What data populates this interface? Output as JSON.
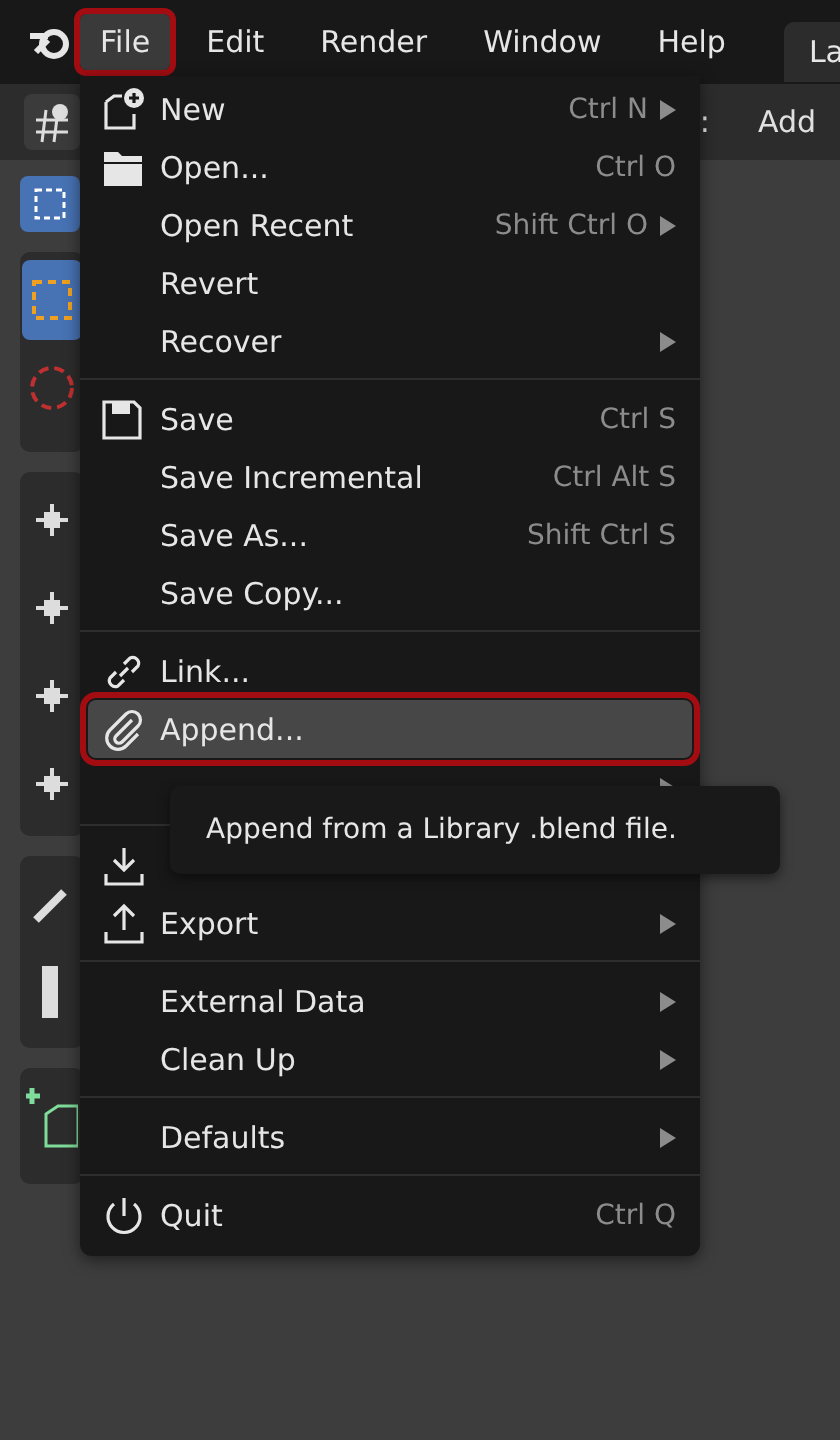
{
  "menubar": {
    "items": [
      {
        "label": "File",
        "selected": true,
        "annotated": true
      },
      {
        "label": "Edit",
        "selected": false,
        "annotated": false
      },
      {
        "label": "Render",
        "selected": false,
        "annotated": false
      },
      {
        "label": "Window",
        "selected": false,
        "annotated": false
      },
      {
        "label": "Help",
        "selected": false,
        "annotated": false
      }
    ],
    "workspace_tab": "La"
  },
  "header": {
    "separator_glyph": ":",
    "add_menu": "Add"
  },
  "file_menu": {
    "items": [
      {
        "kind": "item",
        "label": "New",
        "shortcut": "Ctrl N",
        "submenu": true,
        "selected": false,
        "annotated": false
      },
      {
        "kind": "item",
        "label": "Open...",
        "shortcut": "Ctrl O",
        "submenu": false,
        "selected": false,
        "annotated": false
      },
      {
        "kind": "item",
        "label": "Open Recent",
        "shortcut": "Shift Ctrl O",
        "submenu": true,
        "selected": false,
        "annotated": false
      },
      {
        "kind": "item",
        "label": "Revert",
        "submenu": false,
        "selected": false,
        "annotated": false
      },
      {
        "kind": "item",
        "label": "Recover",
        "submenu": true,
        "selected": false,
        "annotated": false
      },
      {
        "kind": "separator"
      },
      {
        "kind": "item",
        "label": "Save",
        "shortcut": "Ctrl S",
        "submenu": false,
        "selected": false,
        "annotated": false
      },
      {
        "kind": "item",
        "label": "Save Incremental",
        "shortcut": "Ctrl Alt S",
        "submenu": false,
        "selected": false,
        "annotated": false
      },
      {
        "kind": "item",
        "label": "Save As...",
        "shortcut": "Shift Ctrl S",
        "submenu": false,
        "selected": false,
        "annotated": false
      },
      {
        "kind": "item",
        "label": "Save Copy...",
        "submenu": false,
        "selected": false,
        "annotated": false
      },
      {
        "kind": "separator"
      },
      {
        "kind": "item",
        "label": "Link...",
        "submenu": false,
        "selected": false,
        "annotated": false
      },
      {
        "kind": "item",
        "label": "Append...",
        "submenu": false,
        "selected": true,
        "annotated": true
      },
      {
        "kind": "item",
        "submenu": true,
        "selected": false,
        "annotated": false
      },
      {
        "kind": "separator"
      },
      {
        "kind": "item",
        "submenu": false,
        "selected": false,
        "annotated": false
      },
      {
        "kind": "item",
        "label": "Export",
        "submenu": true,
        "selected": false,
        "annotated": false
      },
      {
        "kind": "separator"
      },
      {
        "kind": "item",
        "label": "External Data",
        "submenu": true,
        "selected": false,
        "annotated": false
      },
      {
        "kind": "item",
        "label": "Clean Up",
        "submenu": true,
        "selected": false,
        "annotated": false
      },
      {
        "kind": "separator"
      },
      {
        "kind": "item",
        "label": "Defaults",
        "submenu": true,
        "selected": false,
        "annotated": false
      },
      {
        "kind": "separator"
      },
      {
        "kind": "item",
        "label": "Quit",
        "shortcut": "Ctrl Q",
        "submenu": false,
        "selected": false,
        "annotated": false
      }
    ]
  },
  "tooltip": {
    "text": "Append from a Library .blend file."
  }
}
